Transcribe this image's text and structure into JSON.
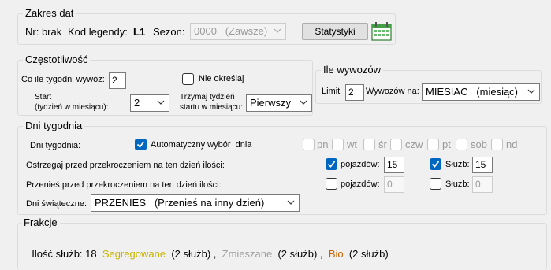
{
  "zakres": {
    "legend": "Zakres dat",
    "nr_label": "Nr: brak",
    "kod_label": "Kod legendy:",
    "kod_value": "L1",
    "sezon_label": "Sezon:",
    "sezon_value": "0000   (Zawsze)",
    "stats_button": "Statystyki",
    "stats_icon": "calendar-chart-icon"
  },
  "czestotliwosc": {
    "legend": "Częstotliwość",
    "co_ile_label": "Co ile tygodni wywóz:",
    "co_ile_value": "2",
    "nieokreslaj_label": "Nie określaj",
    "start_label_1": "Start",
    "start_label_2": "(tydzień w miesiącu):",
    "start_value": "2",
    "trzymaj_label_1": "Trzymaj tydzień",
    "trzymaj_label_2": "startu w miesiącu:",
    "trzymaj_value": "Pierwszy"
  },
  "ile_wywozow": {
    "legend": "Ile wywozów",
    "limit_label": "Limit",
    "limit_value": "2",
    "wywozow_label": "Wywozów na:",
    "wywozow_value": "MIESIAC   (miesiąc)"
  },
  "dni_tygodnia": {
    "legend": "Dni tygodnia",
    "row_label": "Dni tygodnia:",
    "auto_label": "Automatyczny wybór  dnia",
    "days": [
      "pn",
      "wt",
      "śr",
      "czw",
      "pt",
      "sob",
      "nd"
    ],
    "ostrzegaj_label": "Ostrzegaj przed przekroczeniem na ten dzień ilości:",
    "ostrzegaj_pojazdow_label": "pojazdów:",
    "ostrzegaj_pojazdow_value": "15",
    "ostrzegaj_sluzb_label": "Służb:",
    "ostrzegaj_sluzb_value": "15",
    "przenies_label": "Przenieś przed przekroczeniem na ten dzień ilości:",
    "przenies_pojazdow_label": "pojazdów:",
    "przenies_pojazdow_value": "0",
    "przenies_sluzb_label": "Służb:",
    "przenies_sluzb_value": "0",
    "swieta_label": "Dni świąteczne:",
    "swieta_value": "PRZENIES   (Przenieś na inny dzień)"
  },
  "frakcje": {
    "legend": "Frakcje",
    "ilosc_label": "Ilość służb: 18",
    "items": [
      {
        "name": "Segregowane",
        "count": "(2 służb)",
        "sep": ",",
        "color": "#c8b400"
      },
      {
        "name": "Zmieszane",
        "count": "(2 służb)",
        "sep": ",",
        "color": "#a0a0a0"
      },
      {
        "name": "Bio",
        "count": "(2 służb)",
        "sep": "",
        "color": "#c86400"
      }
    ]
  }
}
